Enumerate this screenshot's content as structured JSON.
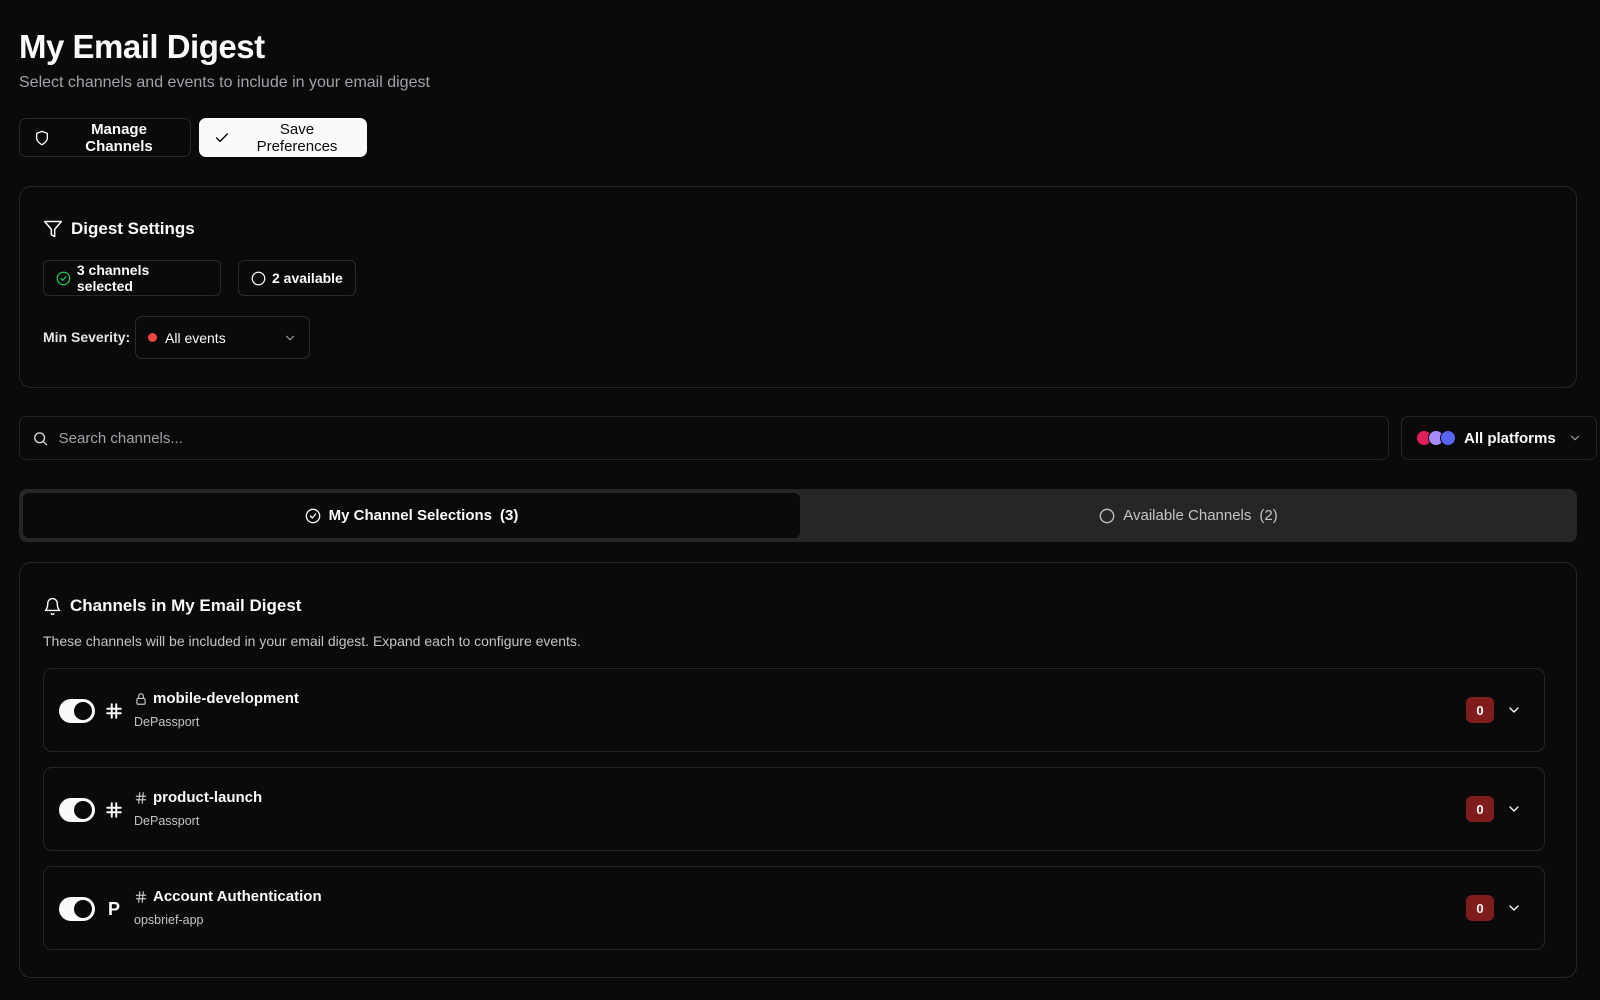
{
  "header": {
    "title": "My Email Digest",
    "subtitle": "Select channels and events to include in your email digest"
  },
  "actions": {
    "manage_label": "Manage Channels",
    "save_label": "Save Preferences"
  },
  "settings": {
    "title": "Digest Settings",
    "selected_label": "3 channels selected",
    "available_label": "2 available",
    "severity_label": "Min Severity:",
    "severity_value": "All events",
    "severity_color": "#ef4444"
  },
  "search": {
    "placeholder": "Search channels...",
    "platform_value": "All platforms"
  },
  "tabs": [
    {
      "label": "My Channel Selections",
      "count": "(3)",
      "active": true
    },
    {
      "label": "Available Channels",
      "count": "(2)",
      "active": false
    }
  ],
  "channels_section": {
    "title": "Channels in My Email Digest",
    "description": "These channels will be included in your email digest. Expand each to configure events.",
    "items": [
      {
        "name": "mobile-development",
        "workspace": "DePassport",
        "platform": "slack-icon",
        "visibility": "lock-icon",
        "enabled": true,
        "count": "0"
      },
      {
        "name": "product-launch",
        "workspace": "DePassport",
        "platform": "slack-icon",
        "visibility": "hash-icon",
        "enabled": true,
        "count": "0"
      },
      {
        "name": "Account Authentication",
        "workspace": "opsbrief-app",
        "platform": "p-logo-icon",
        "platform_glyph": "P",
        "visibility": "hash-icon",
        "enabled": true,
        "count": "0"
      }
    ]
  },
  "colors": {
    "background": "#0a0a0a",
    "border": "#262626",
    "badge": "#7f1d1d",
    "success": "#22c55e"
  }
}
